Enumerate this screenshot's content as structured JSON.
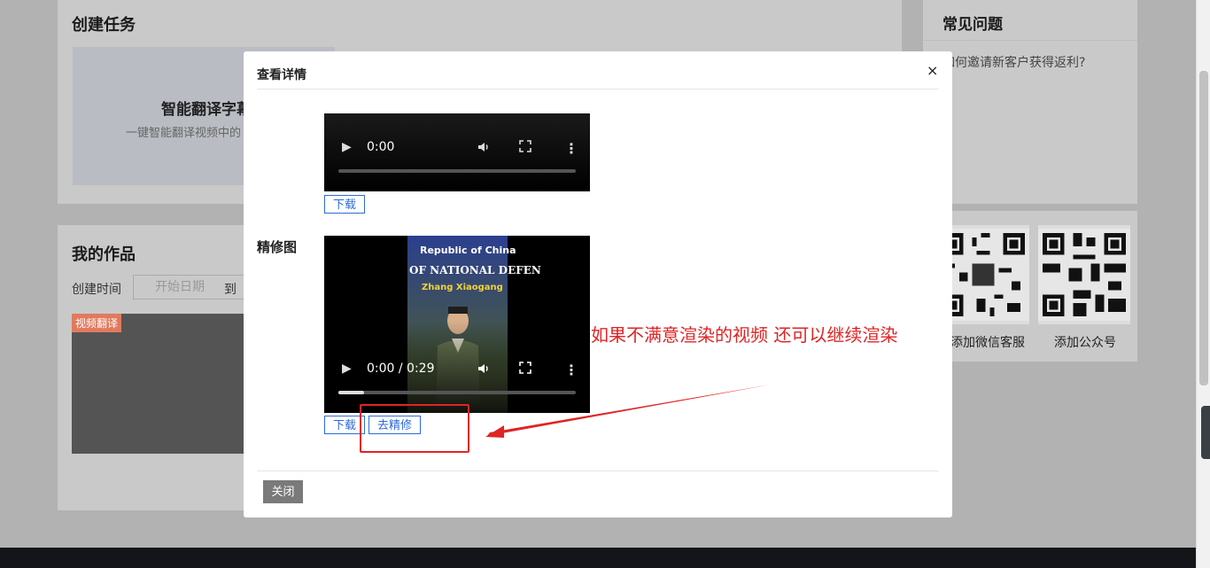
{
  "background": {
    "create_title": "创建任务",
    "card_title": "智能翻译字幕",
    "card_subtitle": "一键智能翻译视频中的",
    "faq_title": "常见问题",
    "faq_item": "如何邀请新客户获得返利?",
    "works_title": "我的作品",
    "date_label": "创建时间",
    "date_placeholder": "开始日期",
    "date_to": "到",
    "work_badge": "视频翻译",
    "qr_label_1": "添加微信客服",
    "qr_label_2": "添加公众号"
  },
  "modal": {
    "title": "查看详情",
    "close_x": "×",
    "video1": {
      "time": "0:00",
      "progress": 0
    },
    "download_label": "下载",
    "section_label": "精修图",
    "video2": {
      "time": "0:00 / 0:29",
      "progress": 0.11,
      "poster_line1": "Republic of China",
      "poster_line2": "OF NATIONAL DEFEN",
      "poster_line3": "Zhang Xiaogang"
    },
    "download_label_2": "下载",
    "refine_label": "去精修",
    "annotation": "如果不满意渲染的视频 还可以继续渲染",
    "close_button": "关闭"
  },
  "icons": {
    "play": "▶",
    "volume": "🔊",
    "fullscreen": "⛶",
    "more": "⋮"
  },
  "colors": {
    "accent": "#2d6bd7",
    "annotation_red": "#e02424",
    "overlay": "#b2b2b2"
  }
}
